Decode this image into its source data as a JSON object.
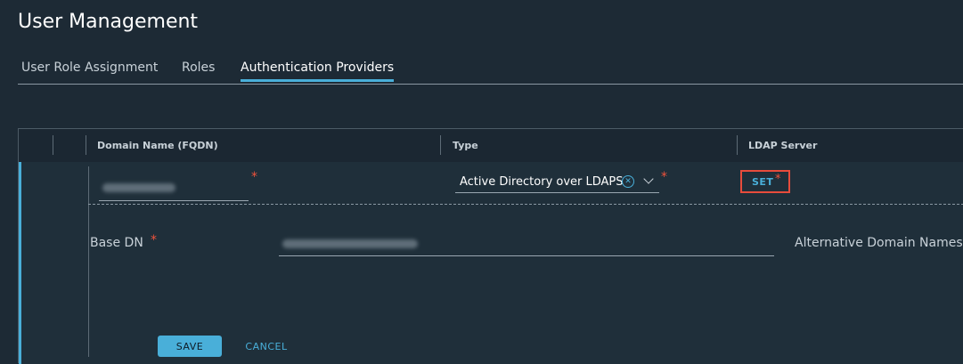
{
  "page": {
    "title": "User Management"
  },
  "tabs": [
    {
      "label": "User Role Assignment",
      "active": false
    },
    {
      "label": "Roles",
      "active": false
    },
    {
      "label": "Authentication Providers",
      "active": true
    }
  ],
  "grid": {
    "columns": [
      "Domain Name (FQDN)",
      "Type",
      "LDAP Server"
    ],
    "row": {
      "required_mark": "*",
      "type_value": "Active Directory over LDAPS",
      "ldap_action": "SET",
      "base_dn_label": "Base DN",
      "alt_domain_label": "Alternative Domain Names"
    },
    "actions": {
      "save": "SAVE",
      "cancel": "CANCEL"
    }
  },
  "icons": {
    "clear": "clear-icon",
    "chevron": "chevron-down-icon"
  },
  "colors": {
    "accent": "#49afd9",
    "required": "#f0533c",
    "highlight": "#e74c3c"
  }
}
